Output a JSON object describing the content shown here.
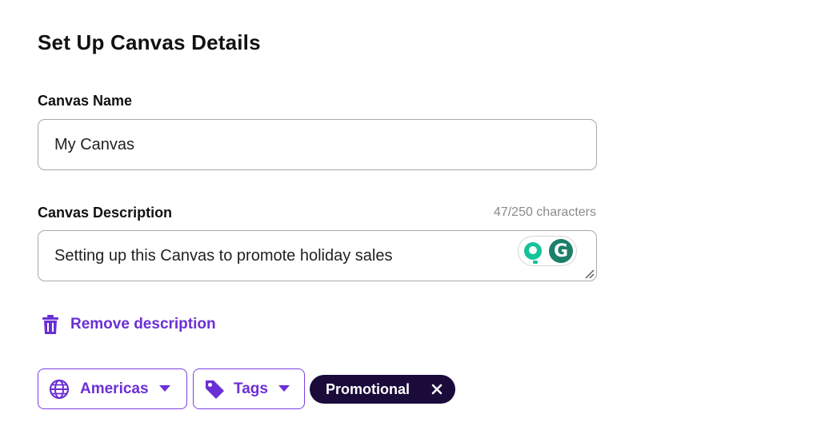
{
  "page": {
    "title": "Set Up Canvas Details"
  },
  "canvas_name": {
    "label": "Canvas Name",
    "value": "My Canvas"
  },
  "canvas_description": {
    "label": "Canvas Description",
    "counter": "47/250 characters",
    "value": "Setting up this Canvas to promote holiday sales",
    "grammarly_icon": "grammarly-icon",
    "suggestion_icon": "lightbulb-icon"
  },
  "remove_description": {
    "label": "Remove description",
    "icon": "trash-icon"
  },
  "filters": {
    "region": {
      "label": "Americas",
      "icon": "globe-icon"
    },
    "tags": {
      "label": "Tags",
      "icon": "tag-icon"
    },
    "selected_tag": {
      "label": "Promotional"
    }
  },
  "colors": {
    "accent": "#6b2fd6",
    "pill_bg": "#1a0b3b",
    "grammarly_green": "#15c39a"
  }
}
